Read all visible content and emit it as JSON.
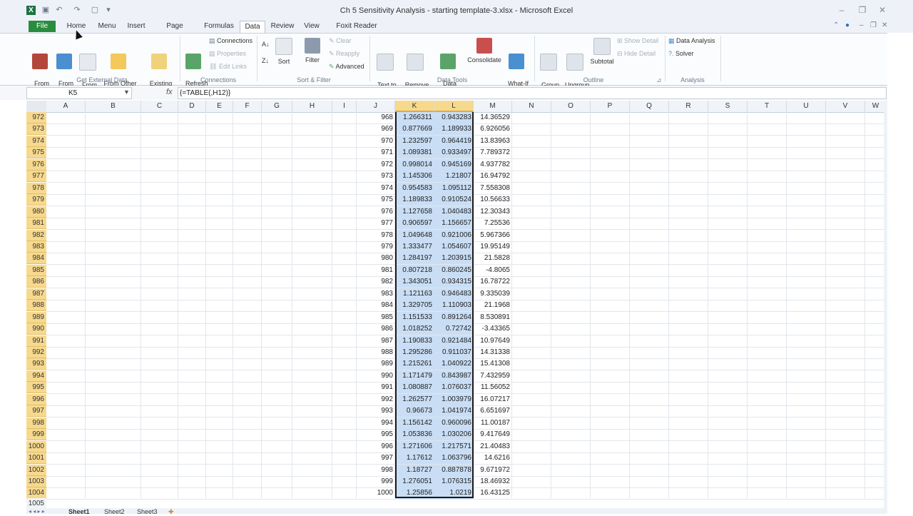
{
  "window": {
    "title": "Ch 5 Sensitivity Analysis - starting template-3.xlsx - Microsoft Excel",
    "app_icon": "X"
  },
  "tabs": [
    "File",
    "Home",
    "Menu",
    "Insert",
    "Page Layout",
    "Formulas",
    "Data",
    "Review",
    "View",
    "Foxit Reader PDF"
  ],
  "active_tab": "Data",
  "ribbon": {
    "get_external": {
      "from_access": "From\nAccess",
      "from_web": "From\nWeb",
      "from_text": "From\nText",
      "from_other": "From Other\nSources ▾",
      "existing": "Existing\nConnections",
      "label": "Get External Data"
    },
    "connections": {
      "refresh": "Refresh\nAll ▾",
      "connections": "Connections",
      "properties": "Properties",
      "edit_links": "Edit Links",
      "label": "Connections"
    },
    "sort_filter": {
      "sort": "Sort",
      "filter": "Filter",
      "clear": "Clear",
      "reapply": "Reapply",
      "advanced": "Advanced",
      "label": "Sort & Filter"
    },
    "data_tools": {
      "text_to_columns": "Text to\nColumns",
      "remove_duplicates": "Remove\nDuplicates",
      "data_validation": "Data\nValidation ▾",
      "consolidate": "Consolidate",
      "what_if": "What-If\nAnalysis ▾",
      "label": "Data Tools"
    },
    "outline": {
      "group": "Group\n▾",
      "ungroup": "Ungroup\n▾",
      "subtotal": "Subtotal",
      "show_detail": "Show Detail",
      "hide_detail": "Hide Detail",
      "label": "Outline"
    },
    "analysis": {
      "data_analysis": "Data Analysis",
      "solver": "Solver",
      "label": "Analysis"
    }
  },
  "formula_bar": {
    "name_box": "K5",
    "fx": "fx",
    "formula": "{=TABLE(,H12)}"
  },
  "columns": [
    "A",
    "B",
    "C",
    "D",
    "E",
    "F",
    "G",
    "H",
    "I",
    "J",
    "K",
    "L",
    "M",
    "N",
    "O",
    "P",
    "Q",
    "R",
    "S",
    "T",
    "U",
    "V",
    "W"
  ],
  "rows": [
    {
      "n": "972",
      "j": "968",
      "k": "1.266311",
      "l": "0.943283",
      "m": "14.36529"
    },
    {
      "n": "973",
      "j": "969",
      "k": "0.877669",
      "l": "1.189933",
      "m": "6.926056"
    },
    {
      "n": "974",
      "j": "970",
      "k": "1.232597",
      "l": "0.964419",
      "m": "13.83963"
    },
    {
      "n": "975",
      "j": "971",
      "k": "1.089381",
      "l": "0.933497",
      "m": "7.789372"
    },
    {
      "n": "976",
      "j": "972",
      "k": "0.998014",
      "l": "0.945169",
      "m": "4.937782"
    },
    {
      "n": "977",
      "j": "973",
      "k": "1.145306",
      "l": "1.21807",
      "m": "16.94792"
    },
    {
      "n": "978",
      "j": "974",
      "k": "0.954583",
      "l": "1.095112",
      "m": "7.558308"
    },
    {
      "n": "979",
      "j": "975",
      "k": "1.189833",
      "l": "0.910524",
      "m": "10.56633"
    },
    {
      "n": "980",
      "j": "976",
      "k": "1.127658",
      "l": "1.040483",
      "m": "12.30343"
    },
    {
      "n": "981",
      "j": "977",
      "k": "0.906597",
      "l": "1.156657",
      "m": "7.25536"
    },
    {
      "n": "982",
      "j": "978",
      "k": "1.049648",
      "l": "0.921006",
      "m": "5.967366"
    },
    {
      "n": "983",
      "j": "979",
      "k": "1.333477",
      "l": "1.054607",
      "m": "19.95149"
    },
    {
      "n": "984",
      "j": "980",
      "k": "1.284197",
      "l": "1.203915",
      "m": "21.5828"
    },
    {
      "n": "985",
      "j": "981",
      "k": "0.807218",
      "l": "0.860245",
      "m": "-4.8065"
    },
    {
      "n": "986",
      "j": "982",
      "k": "1.343051",
      "l": "0.934315",
      "m": "16.78722"
    },
    {
      "n": "987",
      "j": "983",
      "k": "1.121163",
      "l": "0.946483",
      "m": "9.335039"
    },
    {
      "n": "988",
      "j": "984",
      "k": "1.329705",
      "l": "1.110903",
      "m": "21.1968"
    },
    {
      "n": "989",
      "j": "985",
      "k": "1.151533",
      "l": "0.891264",
      "m": "8.530891"
    },
    {
      "n": "990",
      "j": "986",
      "k": "1.018252",
      "l": "0.72742",
      "m": "-3.43365"
    },
    {
      "n": "991",
      "j": "987",
      "k": "1.190833",
      "l": "0.921484",
      "m": "10.97649"
    },
    {
      "n": "992",
      "j": "988",
      "k": "1.295286",
      "l": "0.911037",
      "m": "14.31338"
    },
    {
      "n": "993",
      "j": "989",
      "k": "1.215261",
      "l": "1.040922",
      "m": "15.41308"
    },
    {
      "n": "994",
      "j": "990",
      "k": "1.171479",
      "l": "0.843987",
      "m": "7.432959"
    },
    {
      "n": "995",
      "j": "991",
      "k": "1.080887",
      "l": "1.076037",
      "m": "11.56052"
    },
    {
      "n": "996",
      "j": "992",
      "k": "1.262577",
      "l": "1.003979",
      "m": "16.07217"
    },
    {
      "n": "997",
      "j": "993",
      "k": "0.96673",
      "l": "1.041974",
      "m": "6.651697"
    },
    {
      "n": "998",
      "j": "994",
      "k": "1.156142",
      "l": "0.960096",
      "m": "11.00187"
    },
    {
      "n": "999",
      "j": "995",
      "k": "1.053836",
      "l": "1.030206",
      "m": "9.417649"
    },
    {
      "n": "1000",
      "j": "996",
      "k": "1.271606",
      "l": "1.217571",
      "m": "21.40483"
    },
    {
      "n": "1001",
      "j": "997",
      "k": "1.17612",
      "l": "1.063796",
      "m": "14.6216"
    },
    {
      "n": "1002",
      "j": "998",
      "k": "1.18727",
      "l": "0.887878",
      "m": "9.671972"
    },
    {
      "n": "1003",
      "j": "999",
      "k": "1.276051",
      "l": "1.076315",
      "m": "18.46932"
    },
    {
      "n": "1004",
      "j": "1000",
      "k": "1.25856",
      "l": "1.0219",
      "m": "16.43125"
    }
  ],
  "last_row": "1005",
  "sheets": [
    "Sheet1",
    "Sheet2",
    "Sheet3"
  ],
  "colors": {
    "selection_header": "#f7d98e",
    "selection_fill": "#c9def5",
    "file_tab": "#2a8c3f"
  }
}
